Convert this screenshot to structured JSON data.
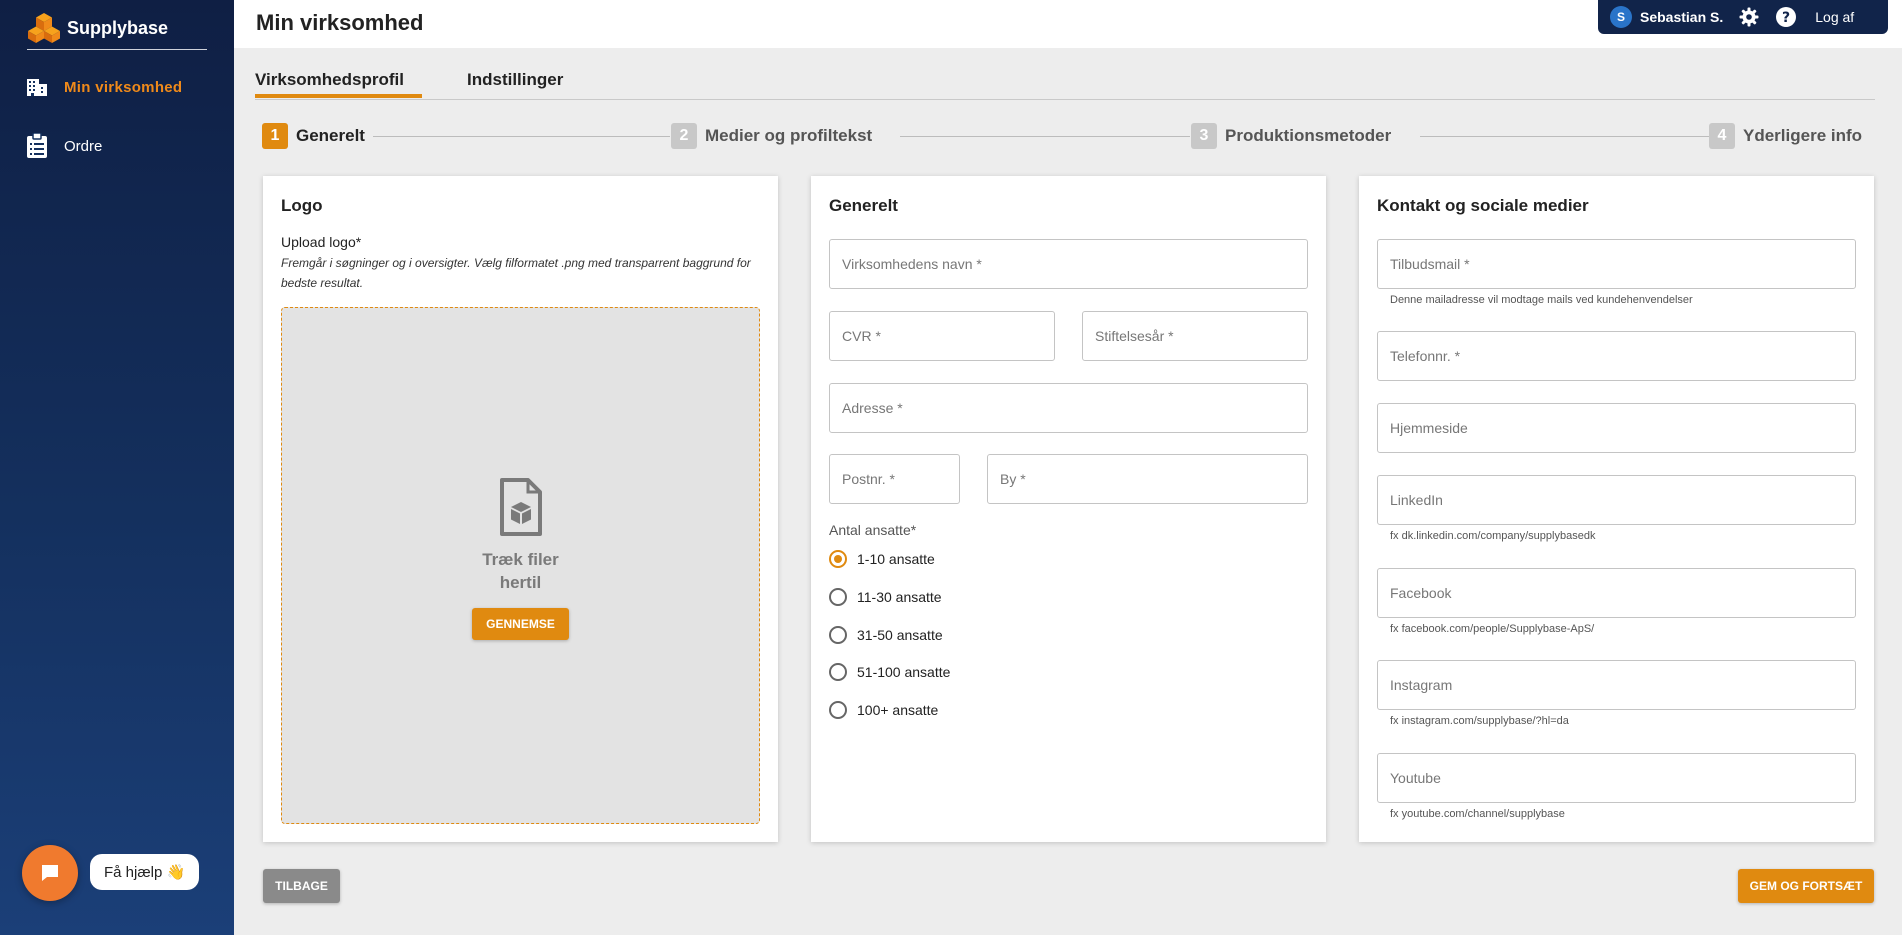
{
  "app": {
    "brand": "Supplybase",
    "brand_color": "#e08a10"
  },
  "sidebar": {
    "items": [
      {
        "label": "Min virksomhed",
        "icon": "building-icon",
        "active": true
      },
      {
        "label": "Ordre",
        "icon": "clipboard-icon",
        "active": false
      }
    ],
    "help_label": "Få hjælp 👋",
    "chat_icon": "chat-icon"
  },
  "header": {
    "title": "Min virksomhed",
    "user": {
      "initial": "S",
      "name": "Sebastian S."
    },
    "logout_label": "Log af",
    "icons": [
      "gear-icon",
      "help-icon"
    ]
  },
  "tabs": [
    {
      "label": "Virksomhedsprofil",
      "active": true
    },
    {
      "label": "Indstillinger",
      "active": false
    }
  ],
  "steps": [
    {
      "num": "1",
      "label": "Generelt",
      "active": true
    },
    {
      "num": "2",
      "label": "Medier og profiltekst",
      "active": false
    },
    {
      "num": "3",
      "label": "Produktionsmetoder",
      "active": false
    },
    {
      "num": "4",
      "label": "Yderligere info",
      "active": false
    }
  ],
  "logo_card": {
    "title": "Logo",
    "upload_label": "Upload logo*",
    "upload_hint": "Fremgår i søgninger og i oversigter. Vælg filformatet .png med transparrent baggrund for bedste resultat.",
    "drop_text": "Træk filer hertil",
    "browse_label": "GENNEMSE",
    "file_icon": "file-box-icon"
  },
  "general_card": {
    "title": "Generelt",
    "fields": {
      "name": {
        "placeholder": "Virksomhedens navn *",
        "value": ""
      },
      "cvr": {
        "placeholder": "CVR *",
        "value": ""
      },
      "founded": {
        "placeholder": "Stiftelsesår *",
        "value": ""
      },
      "address": {
        "placeholder": "Adresse *",
        "value": ""
      },
      "zip": {
        "placeholder": "Postnr. *",
        "value": ""
      },
      "city": {
        "placeholder": "By *",
        "value": ""
      }
    },
    "employees_label": "Antal ansatte*",
    "employee_options": [
      {
        "label": "1-10 ansatte",
        "checked": true
      },
      {
        "label": "11-30 ansatte",
        "checked": false
      },
      {
        "label": "31-50 ansatte",
        "checked": false
      },
      {
        "label": "51-100 ansatte",
        "checked": false
      },
      {
        "label": "100+ ansatte",
        "checked": false
      }
    ]
  },
  "contact_card": {
    "title": "Kontakt og sociale medier",
    "fields": {
      "email": {
        "placeholder": "Tilbudsmail *",
        "helper": "Denne mailadresse vil modtage mails ved kundehenvendelser"
      },
      "phone": {
        "placeholder": "Telefonnr. *"
      },
      "website": {
        "placeholder": "Hjemmeside"
      },
      "linkedin": {
        "placeholder": "LinkedIn",
        "helper": "fx dk.linkedin.com/company/supplybasedk"
      },
      "facebook": {
        "placeholder": "Facebook",
        "helper": "fx facebook.com/people/Supplybase-ApS/"
      },
      "instagram": {
        "placeholder": "Instagram",
        "helper": "fx instagram.com/supplybase/?hl=da"
      },
      "youtube": {
        "placeholder": "Youtube",
        "helper": "fx youtube.com/channel/supplybase"
      }
    }
  },
  "footer": {
    "back_label": "TILBAGE",
    "save_label": "GEM OG FORTSÆT"
  }
}
